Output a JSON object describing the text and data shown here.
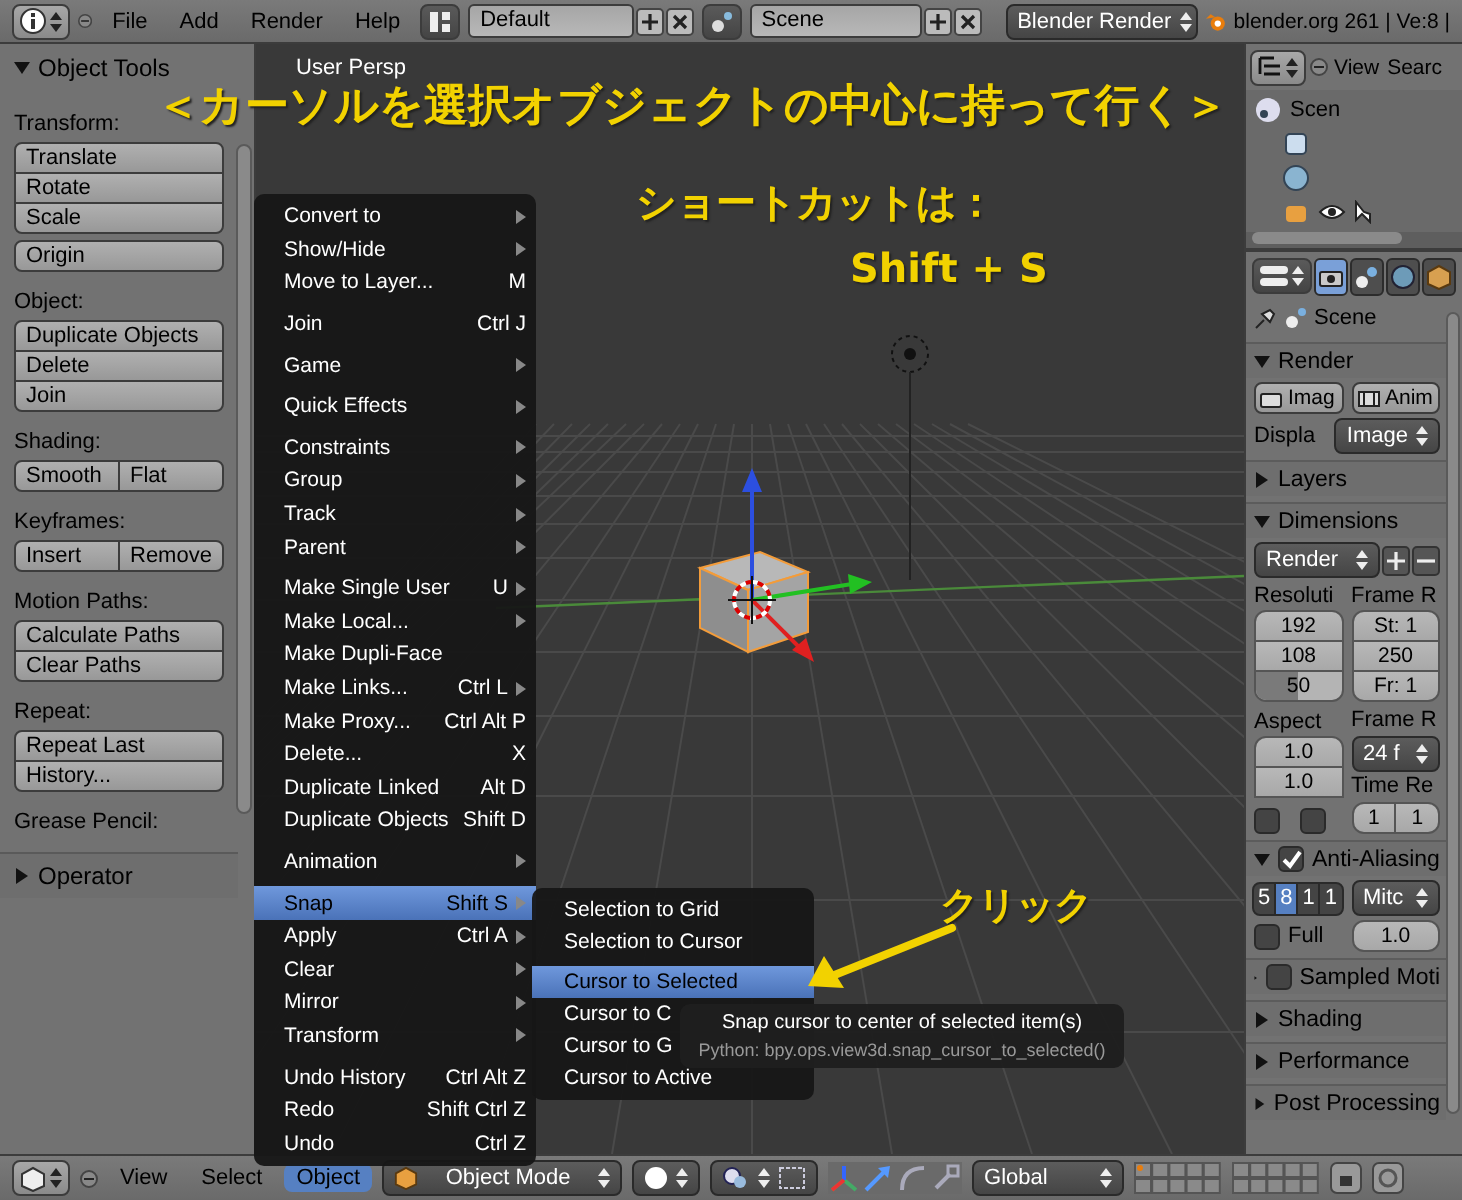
{
  "top_bar": {
    "menus": [
      "File",
      "Add",
      "Render",
      "Help"
    ],
    "screen_layout": "Default",
    "scene": "Scene",
    "render_engine": "Blender Render",
    "stats": "blender.org 261 | Ve:8 |"
  },
  "tool_shelf": {
    "title": "Object Tools",
    "expanded": true,
    "sections": [
      {
        "label": "Transform:",
        "kind": "column",
        "buttons": [
          "Translate",
          "Rotate",
          "Scale"
        ]
      },
      {
        "kind": "column",
        "buttons": [
          "Origin"
        ]
      },
      {
        "label": "Object:",
        "kind": "column",
        "buttons": [
          "Duplicate Objects",
          "Delete",
          "Join"
        ]
      },
      {
        "label": "Shading:",
        "kind": "row",
        "buttons": [
          "Smooth",
          "Flat"
        ]
      },
      {
        "label": "Keyframes:",
        "kind": "row",
        "buttons": [
          "Insert",
          "Remove"
        ]
      },
      {
        "label": "Motion Paths:",
        "kind": "column",
        "buttons": [
          "Calculate Paths",
          "Clear Paths"
        ]
      },
      {
        "label": "Repeat:",
        "kind": "column",
        "buttons": [
          "Repeat Last",
          "History..."
        ]
      },
      {
        "label": "Grease Pencil:"
      }
    ],
    "operator": {
      "title": "Operator",
      "expanded": false
    }
  },
  "viewport": {
    "view_label": "User Persp"
  },
  "object_menu": {
    "groups": [
      {
        "items": [
          {
            "label": "Convert to",
            "submenu": true,
            "selected": false
          },
          {
            "label": "Show/Hide",
            "submenu": true,
            "selected": false
          },
          {
            "label": "Move to Layer...",
            "shortcut": "M",
            "submenu": false,
            "selected": false
          }
        ]
      },
      {
        "items": [
          {
            "label": "Join",
            "shortcut": "Ctrl J",
            "submenu": false,
            "selected": false
          }
        ]
      },
      {
        "items": [
          {
            "label": "Game",
            "submenu": true,
            "selected": false
          }
        ]
      },
      {
        "items": [
          {
            "label": "Quick Effects",
            "submenu": true,
            "selected": false
          }
        ]
      },
      {
        "items": [
          {
            "label": "Constraints",
            "submenu": true,
            "selected": false
          },
          {
            "label": "Group",
            "submenu": true,
            "selected": false
          },
          {
            "label": "Track",
            "submenu": true,
            "selected": false
          },
          {
            "label": "Parent",
            "submenu": true,
            "selected": false
          }
        ]
      },
      {
        "items": [
          {
            "label": "Make Single User",
            "shortcut": "U",
            "submenu": true,
            "selected": false
          },
          {
            "label": "Make Local...",
            "submenu": true,
            "selected": false
          },
          {
            "label": "Make Dupli-Face",
            "submenu": false,
            "selected": false
          },
          {
            "label": "Make Links...",
            "shortcut": "Ctrl L",
            "submenu": true,
            "selected": false
          },
          {
            "label": "Make Proxy...",
            "shortcut": "Ctrl Alt P",
            "submenu": false,
            "selected": false
          },
          {
            "label": "Delete...",
            "shortcut": "X",
            "submenu": false,
            "selected": false
          },
          {
            "label": "Duplicate Linked",
            "shortcut": "Alt D",
            "submenu": false,
            "selected": false
          },
          {
            "label": "Duplicate Objects",
            "shortcut": "Shift D",
            "submenu": false,
            "selected": false
          }
        ]
      },
      {
        "items": [
          {
            "label": "Animation",
            "submenu": true,
            "selected": false
          }
        ]
      },
      {
        "items": [
          {
            "label": "Snap",
            "shortcut": "Shift S",
            "submenu": true,
            "selected": true
          },
          {
            "label": "Apply",
            "shortcut": "Ctrl A",
            "submenu": true,
            "selected": false
          },
          {
            "label": "Clear",
            "submenu": true,
            "selected": false
          },
          {
            "label": "Mirror",
            "submenu": true,
            "selected": false
          },
          {
            "label": "Transform",
            "submenu": true,
            "selected": false
          }
        ]
      },
      {
        "items": [
          {
            "label": "Undo History",
            "shortcut": "Ctrl Alt Z",
            "submenu": false,
            "selected": false
          },
          {
            "label": "Redo",
            "shortcut": "Shift Ctrl Z",
            "submenu": false,
            "selected": false
          },
          {
            "label": "Undo",
            "shortcut": "Ctrl Z",
            "submenu": false,
            "selected": false
          }
        ]
      }
    ]
  },
  "snap_submenu": {
    "groups": [
      {
        "items": [
          {
            "label": "Selection to Grid",
            "selected": false
          },
          {
            "label": "Selection to Cursor",
            "selected": false
          }
        ]
      },
      {
        "items": [
          {
            "label": "Cursor to Selected",
            "selected": true
          },
          {
            "label": "Cursor to C",
            "selected": false
          },
          {
            "label": "Cursor to G",
            "selected": false
          },
          {
            "label": "Cursor to Active",
            "selected": false
          }
        ]
      }
    ]
  },
  "tooltip": {
    "description": "Snap cursor to center of selected item(s)",
    "python": "Python: bpy.ops.view3d.snap_cursor_to_selected()"
  },
  "annotations": {
    "title": "＜カーソルを選択オブジェクトの中心に持って行く＞",
    "shortcut_label": "ショートカットは：",
    "shortcut": "Shift + S",
    "click_label": "クリック"
  },
  "outliner": {
    "menus": [
      "View",
      "Searc"
    ],
    "tree_label": "Scen"
  },
  "properties": {
    "tabs": [
      {
        "kind": "render",
        "selected": true
      },
      {
        "kind": "scene",
        "selected": false
      },
      {
        "kind": "world",
        "selected": false
      },
      {
        "kind": "object",
        "selected": false
      }
    ],
    "context": "Scene",
    "render_panel": {
      "title": "Render",
      "expanded": true,
      "buttons": [
        "Imag",
        "Anim"
      ],
      "display_label": "Displa",
      "display_value": "Image"
    },
    "layers_panel": {
      "title": "Layers",
      "expanded": false
    },
    "dimensions_panel": {
      "title": "Dimensions",
      "expanded": true,
      "preset": "Render",
      "resolution_label": "Resoluti",
      "resolution_fields": [
        "192",
        "108"
      ],
      "resolution_percent": {
        "text": "50",
        "level": 0.5
      },
      "frame_range_label": "Frame R",
      "frame_fields": [
        "St: 1",
        "250",
        "Fr: 1"
      ],
      "aspect_label": "Aspect",
      "aspect_fields": [
        "1.0",
        "1.0"
      ],
      "frame_rate_label": "Frame R",
      "frame_rate": "24 f",
      "options": [
        {
          "checked": false
        },
        {
          "checked": false
        }
      ],
      "time_remap_label": "Time Re",
      "time_remap": [
        "1",
        "1"
      ]
    },
    "anti_aliasing_panel": {
      "title": "Anti-Aliasing",
      "expanded": true,
      "checked": true,
      "samples": [
        {
          "label": "5",
          "selected": false
        },
        {
          "label": "8",
          "selected": true
        },
        {
          "label": "1",
          "selected": false
        },
        {
          "label": "1",
          "selected": false
        }
      ],
      "filter": "Mitc",
      "full_sample": {
        "label": "Full",
        "checked": false
      },
      "filter_size": "1.0"
    },
    "collapsed_panels": [
      {
        "title": "Sampled Moti",
        "kind": "checkbox",
        "checked": false,
        "expanded": false
      },
      {
        "title": "Shading",
        "kind": "plain",
        "expanded": false
      },
      {
        "title": "Performance",
        "kind": "plain",
        "expanded": false
      },
      {
        "title": "Post Processing",
        "kind": "plain",
        "expanded": false
      }
    ]
  },
  "bottom_bar": {
    "menus": [
      {
        "label": "View",
        "selected": false
      },
      {
        "label": "Select",
        "selected": false
      },
      {
        "label": "Object",
        "selected": true
      }
    ],
    "mode": "Object Mode",
    "orientation": "Global"
  }
}
